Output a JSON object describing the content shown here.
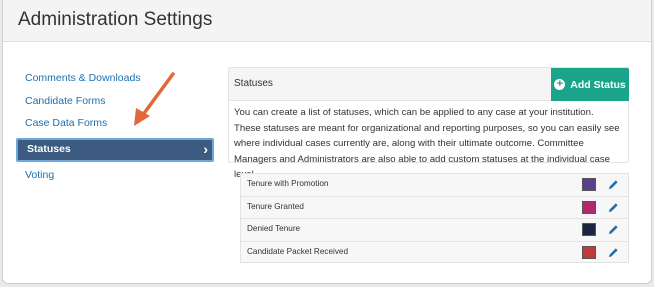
{
  "header": {
    "title": "Administration Settings"
  },
  "nav": {
    "items": [
      {
        "label": "Comments & Downloads",
        "active": false
      },
      {
        "label": "Candidate Forms",
        "active": false
      },
      {
        "label": "Case Data Forms",
        "active": false
      },
      {
        "label": "Statuses",
        "active": true,
        "icon": "chevron-right-icon"
      },
      {
        "label": "Voting",
        "active": false
      }
    ]
  },
  "statuses_panel": {
    "title": "Statuses",
    "add_button_label": "Add Status",
    "add_button_icon": "plus-circle-icon",
    "description": "You can create a list of statuses, which can be applied to any case at your institution. These statuses are meant for organizational and reporting purposes, so you can easily see where individual cases currently are, along with their ultimate outcome. Committee Managers and Administrators are also able to add custom statuses at the individual case level.",
    "accent_color": "#1aa58b"
  },
  "status_list": [
    {
      "name": "Tenure with Promotion",
      "color": "#5a3f8a"
    },
    {
      "name": "Tenure Granted",
      "color": "#b02a6d"
    },
    {
      "name": "Denied Tenure",
      "color": "#1c2540"
    },
    {
      "name": "Candidate Packet Received",
      "color": "#c0393b"
    }
  ],
  "annotation": {
    "arrow_color": "#e2673a"
  }
}
